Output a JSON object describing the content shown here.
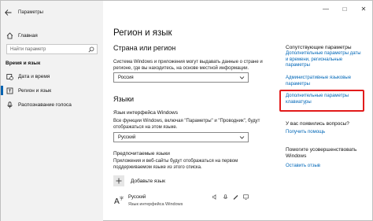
{
  "window": {
    "title": "Параметры",
    "controls": [
      "—",
      "□",
      "✕"
    ]
  },
  "sidebar": {
    "home_label": "Главная",
    "search_placeholder": "Найти параметр",
    "section_title": "Время и язык",
    "items": [
      {
        "label": "Дата и время",
        "icon": "calendar-clock-icon"
      },
      {
        "label": "Регион и язык",
        "icon": "globe-language-icon"
      },
      {
        "label": "Распознавание голоса",
        "icon": "microphone-icon"
      }
    ]
  },
  "main": {
    "title": "Регион и язык",
    "country": {
      "heading": "Страна или регион",
      "description": "Система Windows и приложения могут выдавать данные о стране и регионе, где вы находитесь, на основе местной информации.",
      "selected": "Россия"
    },
    "languages": {
      "heading": "Языки",
      "ui_language_title": "Язык интерфейса Windows",
      "ui_language_desc": "Все функции Windows, включая \"Параметры\" и \"Проводник\", будут отображаться на этом языке.",
      "ui_language_selected": "Русский",
      "preferred_title": "Предпочитаемые языки",
      "preferred_desc": "Приложения и веб-сайты будут отображаться на первом поддерживаемом языке из этого списка.",
      "add_label": "Добавьте язык",
      "items": [
        {
          "name": "Русский",
          "sub": "Язык интерфейса Windows"
        }
      ]
    }
  },
  "right": {
    "related_title": "Сопутствующие параметры",
    "link_date": "Дополнительные параметры даты и времени, региональные параметры",
    "link_admin": "Административные языковые параметры",
    "link_keyboard": "Дополнительные параметры клавиатуры",
    "question_title": "У вас появились вопросы?",
    "link_help": "Получить помощь",
    "improve_title": "Помогите усовершенствовать Windows",
    "link_feedback": "Оставить отзыв"
  },
  "colors": {
    "accent": "#0067b8",
    "highlight": "#e21b1b",
    "sidebar_bg": "#f2f2f2"
  }
}
